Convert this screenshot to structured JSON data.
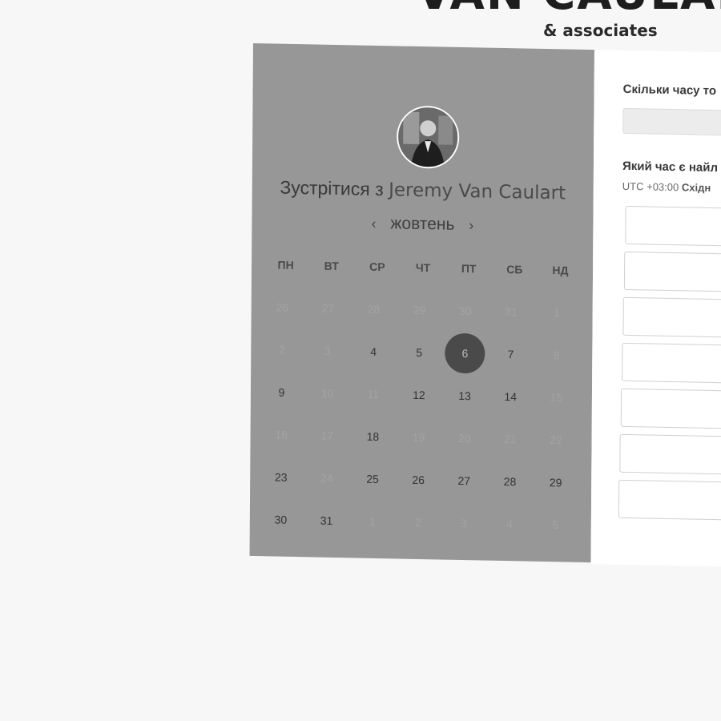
{
  "brand": {
    "name": "VAN CAULART",
    "tagline": "& associates"
  },
  "scheduler": {
    "title_prefix": "Зустрітися з",
    "host_name": "Jeremy Van Caulart",
    "month": "жовтень",
    "prev_icon": "chevron-left-icon",
    "next_icon": "chevron-right-icon",
    "weekdays": [
      "ПН",
      "ВТ",
      "СР",
      "ЧТ",
      "ПТ",
      "СБ",
      "НД"
    ],
    "days": [
      {
        "d": "26",
        "s": "muted"
      },
      {
        "d": "27",
        "s": "muted"
      },
      {
        "d": "28",
        "s": "muted"
      },
      {
        "d": "29",
        "s": "muted"
      },
      {
        "d": "30",
        "s": "muted"
      },
      {
        "d": "31",
        "s": "muted"
      },
      {
        "d": "1",
        "s": "muted"
      },
      {
        "d": "2",
        "s": "muted"
      },
      {
        "d": "3",
        "s": "muted"
      },
      {
        "d": "4",
        "s": "avail"
      },
      {
        "d": "5",
        "s": "avail"
      },
      {
        "d": "6",
        "s": "selected"
      },
      {
        "d": "7",
        "s": "avail"
      },
      {
        "d": "8",
        "s": "muted"
      },
      {
        "d": "9",
        "s": "avail"
      },
      {
        "d": "10",
        "s": "muted"
      },
      {
        "d": "11",
        "s": "muted"
      },
      {
        "d": "12",
        "s": "avail"
      },
      {
        "d": "13",
        "s": "avail"
      },
      {
        "d": "14",
        "s": "avail"
      },
      {
        "d": "15",
        "s": "muted"
      },
      {
        "d": "16",
        "s": "muted"
      },
      {
        "d": "17",
        "s": "muted"
      },
      {
        "d": "18",
        "s": "avail"
      },
      {
        "d": "19",
        "s": "muted"
      },
      {
        "d": "20",
        "s": "muted"
      },
      {
        "d": "21",
        "s": "muted"
      },
      {
        "d": "22",
        "s": "muted"
      },
      {
        "d": "23",
        "s": "avail"
      },
      {
        "d": "24",
        "s": "muted"
      },
      {
        "d": "25",
        "s": "avail"
      },
      {
        "d": "26",
        "s": "avail"
      },
      {
        "d": "27",
        "s": "avail"
      },
      {
        "d": "28",
        "s": "avail"
      },
      {
        "d": "29",
        "s": "avail"
      },
      {
        "d": "30",
        "s": "avail"
      },
      {
        "d": "31",
        "s": "avail"
      },
      {
        "d": "1",
        "s": "muted"
      },
      {
        "d": "2",
        "s": "muted"
      },
      {
        "d": "3",
        "s": "muted"
      },
      {
        "d": "4",
        "s": "muted"
      },
      {
        "d": "5",
        "s": "muted"
      }
    ]
  },
  "booking": {
    "duration_question": "Скільки часу то",
    "time_question": "Який час є найл",
    "timezone_offset": "UTC +03:00",
    "timezone_name": "Східн",
    "slot_count": 7
  },
  "colors": {
    "left_panel": "#979797",
    "selected_day": "#4a4a4a",
    "page_bg": "#f7f7f7"
  }
}
